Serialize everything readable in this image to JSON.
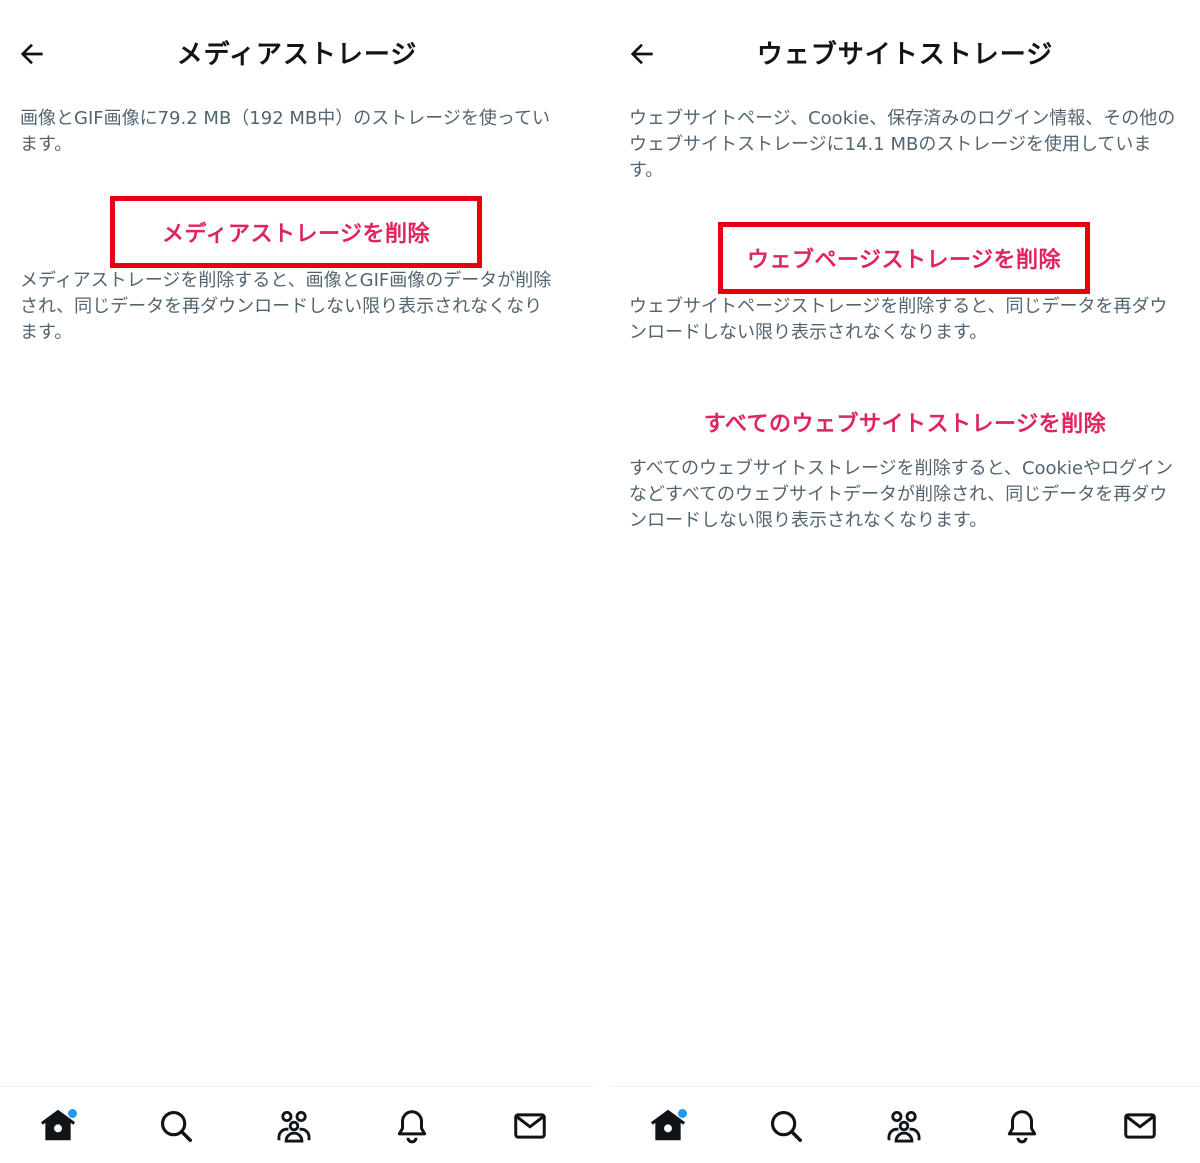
{
  "colors": {
    "accent_red": "#e0245e",
    "highlight_box": "#e60012",
    "secondary_text": "#536471",
    "notification_dot": "#1d9bf0"
  },
  "media_panel": {
    "title": "メディアストレージ",
    "description": "画像とGIF画像に79.2 MB（192 MB中）のストレージを使っています。",
    "delete_label": "メディアストレージを削除",
    "delete_note": "メディアストレージを削除すると、画像とGIF画像のデータが削除され、同じデータを再ダウンロードしない限り表示されなくなります。"
  },
  "website_panel": {
    "title": "ウェブサイトストレージ",
    "description": "ウェブサイトページ、Cookie、保存済みのログイン情報、その他のウェブサイトストレージに14.1 MBのストレージを使用しています。",
    "delete_pages_label": "ウェブページストレージを削除",
    "delete_pages_note": "ウェブサイトページストレージを削除すると、同じデータを再ダウンロードしない限り表示されなくなります。",
    "delete_all_label": "すべてのウェブサイトストレージを削除",
    "delete_all_note": "すべてのウェブサイトストレージを削除すると、Cookieやログインなどすべてのウェブサイトデータが削除され、同じデータを再ダウンロードしない限り表示されなくなります。"
  },
  "tabbar": {
    "icons": [
      "home-icon",
      "search-icon",
      "communities-icon",
      "notifications-icon",
      "messages-icon"
    ]
  }
}
